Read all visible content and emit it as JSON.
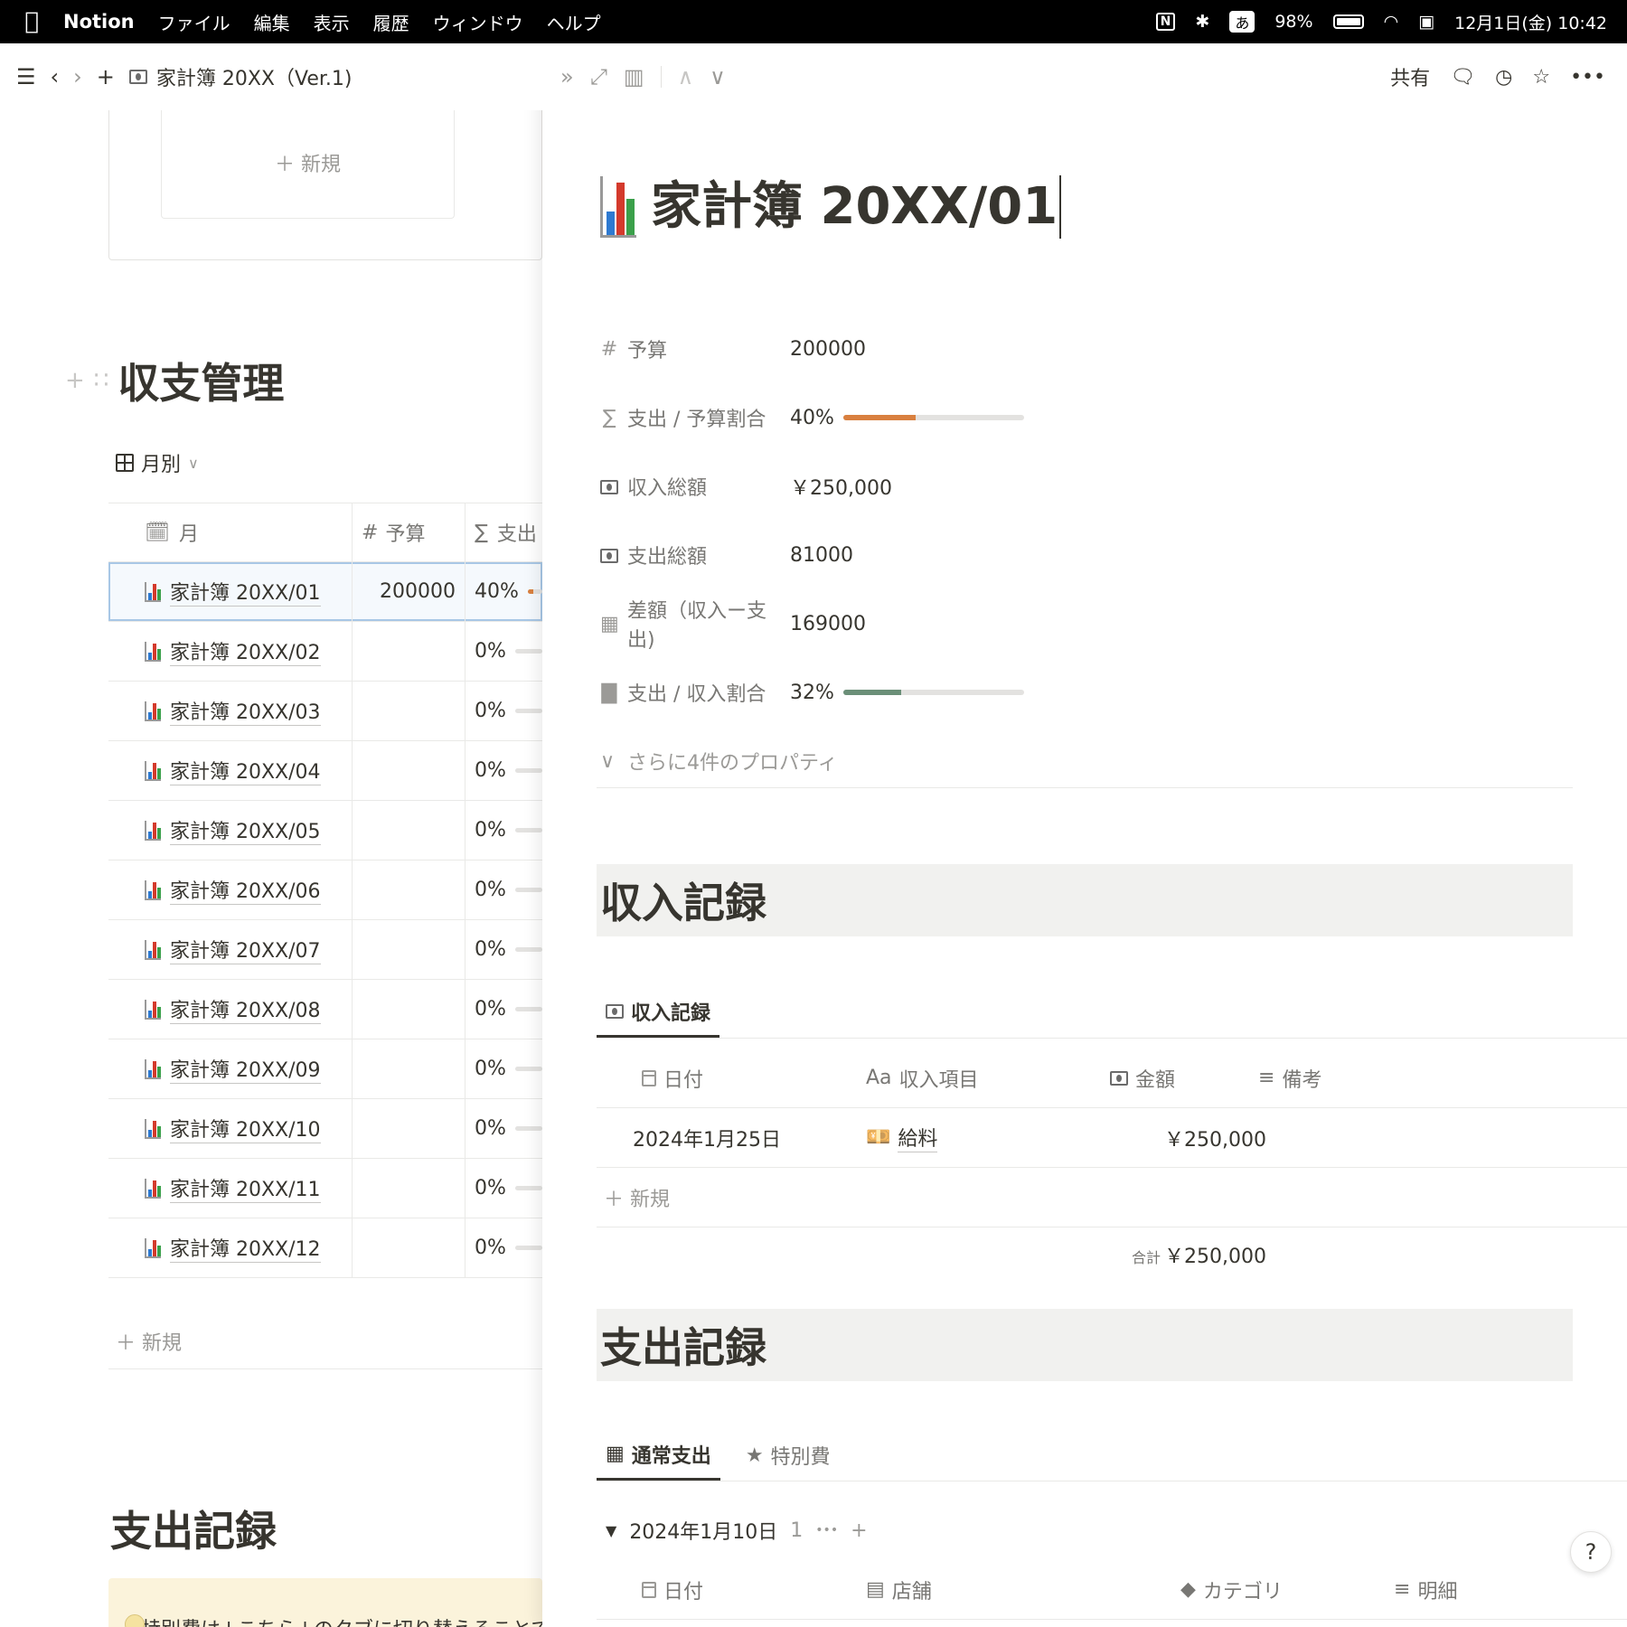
{
  "menubar": {
    "app": "Notion",
    "items": [
      "ファイル",
      "編集",
      "表示",
      "履歴",
      "ウィンドウ",
      "ヘルプ"
    ],
    "ime": "あ",
    "battery": "98%",
    "datetime": "12月1日(金) 10:42",
    "notion_badge": "N"
  },
  "left": {
    "breadcrumb": "家計簿 20XX（Ver.1)",
    "board_new": "＋ 新規",
    "section_income": "収支管理",
    "view_tab": "月別",
    "columns": {
      "month": "月",
      "budget": "予算",
      "ratio": "支出 /"
    },
    "rows": [
      {
        "title": "家計簿 20XX/01",
        "budget": "200000",
        "ratio": "40%",
        "fill": 0.4
      },
      {
        "title": "家計簿 20XX/02",
        "budget": "",
        "ratio": "0%",
        "fill": 0
      },
      {
        "title": "家計簿 20XX/03",
        "budget": "",
        "ratio": "0%",
        "fill": 0
      },
      {
        "title": "家計簿 20XX/04",
        "budget": "",
        "ratio": "0%",
        "fill": 0
      },
      {
        "title": "家計簿 20XX/05",
        "budget": "",
        "ratio": "0%",
        "fill": 0
      },
      {
        "title": "家計簿 20XX/06",
        "budget": "",
        "ratio": "0%",
        "fill": 0
      },
      {
        "title": "家計簿 20XX/07",
        "budget": "",
        "ratio": "0%",
        "fill": 0
      },
      {
        "title": "家計簿 20XX/08",
        "budget": "",
        "ratio": "0%",
        "fill": 0
      },
      {
        "title": "家計簿 20XX/09",
        "budget": "",
        "ratio": "0%",
        "fill": 0
      },
      {
        "title": "家計簿 20XX/10",
        "budget": "",
        "ratio": "0%",
        "fill": 0
      },
      {
        "title": "家計簿 20XX/11",
        "budget": "",
        "ratio": "0%",
        "fill": 0
      },
      {
        "title": "家計簿 20XX/12",
        "budget": "",
        "ratio": "0%",
        "fill": 0
      }
    ],
    "new_row": "＋ 新規",
    "section_expense": "支出記録",
    "callout": "特別費は↓こちら↓のタブに切り替えることでご確認い"
  },
  "peek": {
    "share": "共有",
    "title": "家計簿 20XX/01",
    "props": {
      "budget": {
        "label": "予算",
        "value": "200000"
      },
      "exp_budget": {
        "label": "支出 / 予算割合",
        "value": "40%",
        "fill": 0.4,
        "color": "#d9803f"
      },
      "income_total": {
        "label": "収入総額",
        "value": "￥250,000"
      },
      "expense_total": {
        "label": "支出総額",
        "value": "81000"
      },
      "diff": {
        "label": "差額（収入ー支出)",
        "value": "169000"
      },
      "exp_income": {
        "label": "支出 / 収入割合",
        "value": "32%",
        "fill": 0.32,
        "color": "#6b8f78"
      }
    },
    "more_props": "さらに4件のプロパティ",
    "income_section": {
      "heading": "収入記録",
      "tab": "収入記録",
      "columns": {
        "date": "日付",
        "item": "収入項目",
        "amount": "金額",
        "note": "備考"
      },
      "row": {
        "date": "2024年1月25日",
        "item": "給料",
        "amount": "￥250,000"
      },
      "new_row": "＋ 新規",
      "sum_label": "合計",
      "sum_value": "￥250,000"
    },
    "expense_section": {
      "heading": "支出記録",
      "tabs": [
        "通常支出",
        "特別費"
      ],
      "group_label": "2024年1月10日",
      "group_count": "1",
      "columns": {
        "date": "日付",
        "shop": "店舗",
        "category": "カテゴリ",
        "detail": "明細"
      }
    },
    "help": "?"
  }
}
